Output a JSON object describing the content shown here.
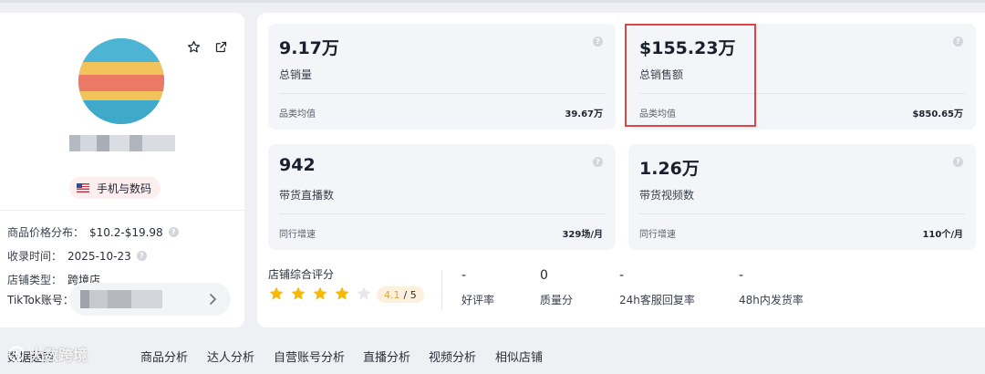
{
  "profile": {
    "category": "手机与数码",
    "price_label": "商品价格分布：",
    "price_value": "$10.2-$19.98",
    "date_label": "收录时间：",
    "date_value": "2025-10-23",
    "type_label": "店铺类型：",
    "type_value": "跨境店",
    "tiktok_label": "TikTok账号："
  },
  "cards": [
    {
      "value": "9.17万",
      "label": "总销量",
      "sub_label": "品类均值",
      "sub_value": "39.67万"
    },
    {
      "value": "$155.23万",
      "label": "总销售额",
      "sub_label": "品类均值",
      "sub_value": "$850.65万"
    },
    {
      "value": "942",
      "label": "带货直播数",
      "sub_label": "同行增速",
      "sub_value": "329场/月"
    },
    {
      "value": "1.26万",
      "label": "带货视频数",
      "sub_label": "同行增速",
      "sub_value": "110个/月"
    }
  ],
  "rating": {
    "title": "店铺综合评分",
    "score": "4.1",
    "max": "/ 5",
    "stars_filled": 4,
    "stars_total": 5
  },
  "metrics": [
    {
      "value": "-",
      "label": "好评率"
    },
    {
      "value": "0",
      "label": "质量分"
    },
    {
      "value": "-",
      "label": "24h客服回复率"
    },
    {
      "value": "-",
      "label": "48h内发货率"
    }
  ],
  "tabs": [
    "数据趋势",
    "商品分析",
    "达人分析",
    "自营账号分析",
    "直播分析",
    "视频分析",
    "相似店铺"
  ],
  "watermark": "大数跨境",
  "colors": {
    "highlight": "#e24444",
    "star": "#f5b90a",
    "tag_bg": "#fdeef0"
  }
}
